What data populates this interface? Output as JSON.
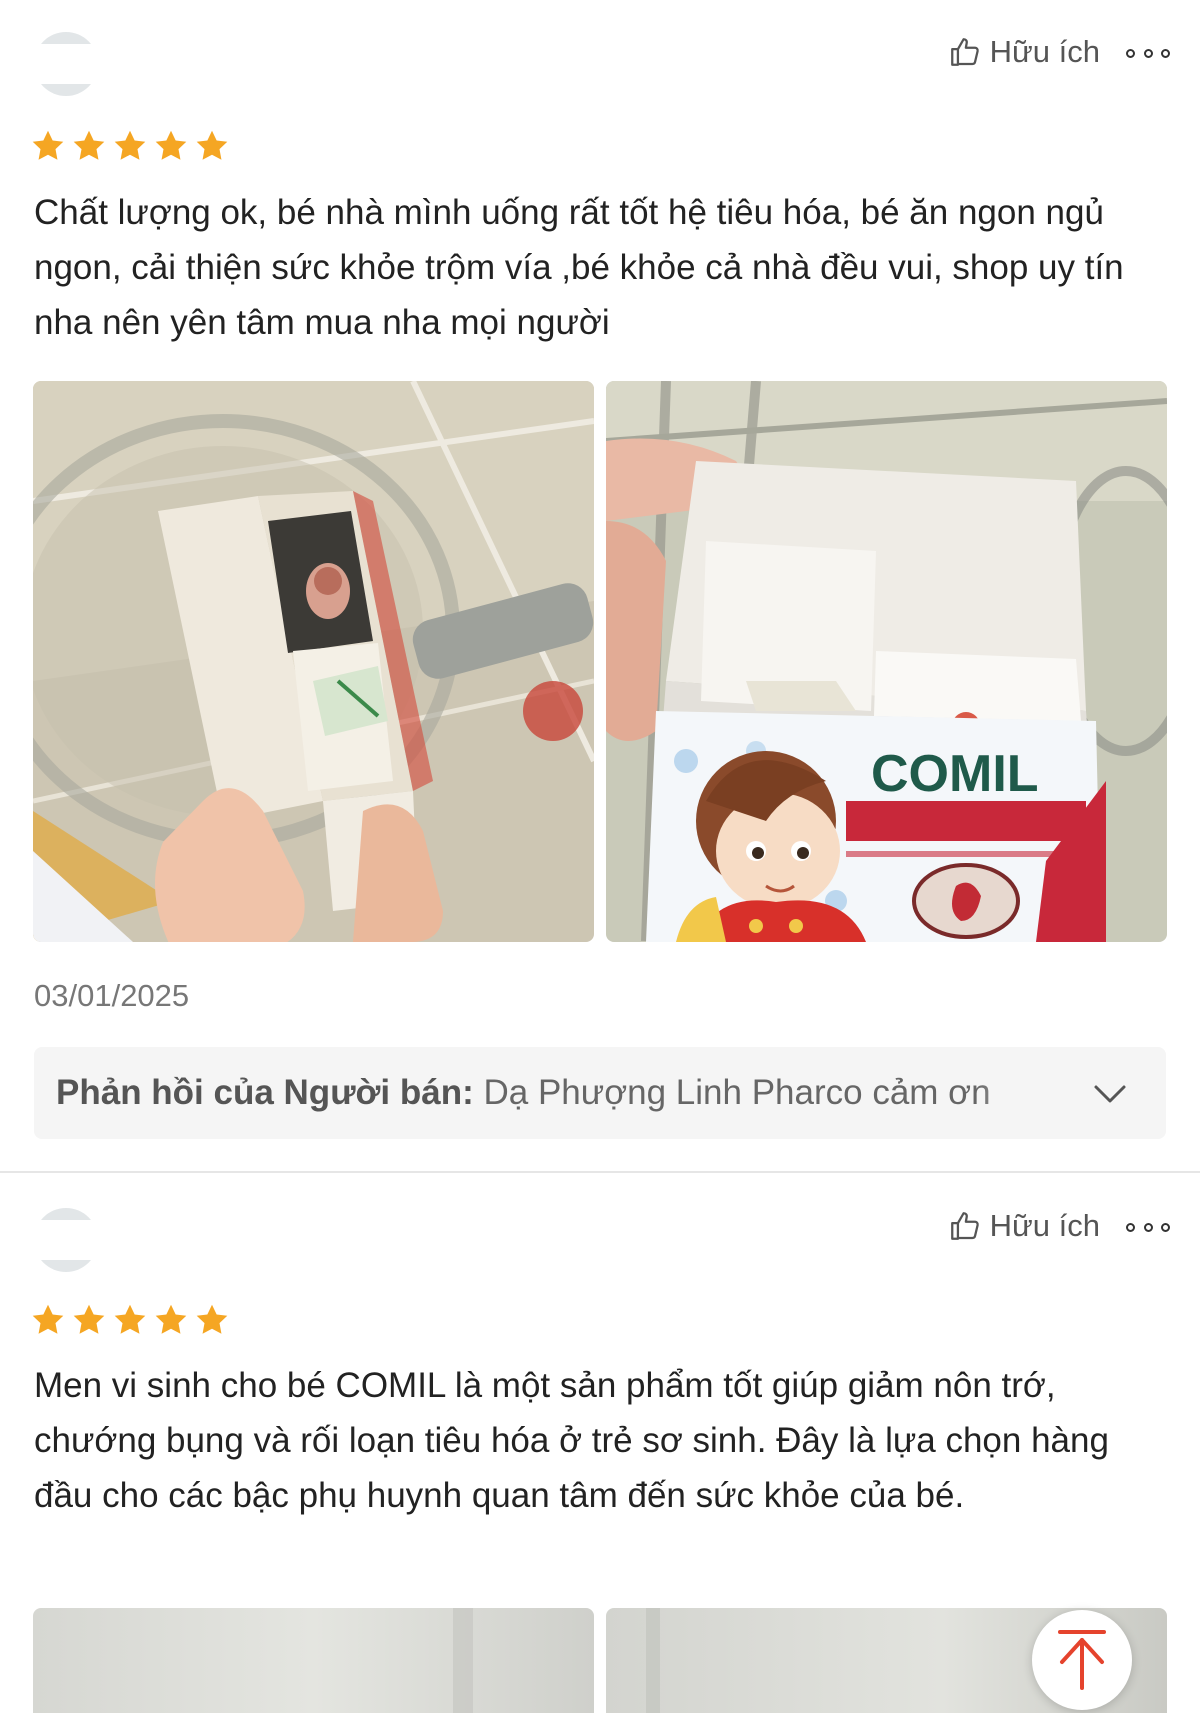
{
  "reviews": [
    {
      "helpful_label": "Hữu ích",
      "rating": 5,
      "text": "Chất lượng ok, bé nhà mình uống rất tốt hệ tiêu hóa, bé ăn ngon ngủ ngon, cải thiện sức khỏe trộm vía ,bé khỏe cả nhà đều vui, shop uy tín nha nên yên tâm mua nha mọi người",
      "date": "03/01/2025",
      "seller_reply_label": "Phản hồi của Người bán:",
      "seller_reply_text": "Dạ Phượng Linh Pharco cảm ơn",
      "photo_2_brand": "COMIL"
    },
    {
      "helpful_label": "Hữu ích",
      "rating": 5,
      "text": "Men vi sinh cho bé COMIL là một sản phẩm tốt giúp giảm nôn trớ, chướng bụng và rối loạn tiêu hóa ở trẻ sơ sinh. Đây là lựa chọn hàng đầu cho các bậc phụ huynh quan tâm đến sức khỏe của bé."
    }
  ],
  "colors": {
    "star": "#f5a623",
    "accent": "#e5432d"
  },
  "icons": [
    "thumbs-up-icon",
    "more-icon",
    "star-icon",
    "chevron-down-icon",
    "arrow-up-icon"
  ]
}
